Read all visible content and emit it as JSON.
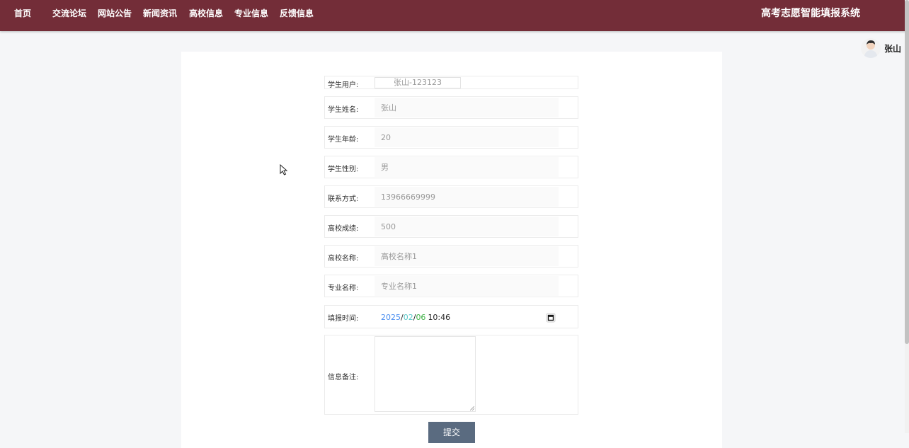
{
  "nav": {
    "items": [
      "首页",
      "交流论坛",
      "网站公告",
      "新闻资讯",
      "高校信息",
      "专业信息",
      "反馈信息"
    ],
    "brand": "高考志愿智能填报系统",
    "bg_color": "#732d38"
  },
  "user": {
    "name": "张山",
    "avatar_icon": "user-avatar"
  },
  "form": {
    "student_user_label": "学生用户:",
    "student_user_value": "张山-123123",
    "name_label": "学生姓名:",
    "name_value": "张山",
    "age_label": "学生年龄:",
    "age_value": "20",
    "gender_label": "学生性别:",
    "gender_value": "男",
    "phone_label": "联系方式:",
    "phone_value": "13966669999",
    "score_label": "高校成绩:",
    "score_value": "500",
    "school_label": "高校名称:",
    "school_value": "高校名称1",
    "major_label": "专业名称:",
    "major_value": "专业名称1",
    "time_label": "填报时间:",
    "time_year": "2025",
    "time_month": "02",
    "time_day": "06",
    "time_clock": "10:46",
    "date_sep": "/",
    "note_label": "信息备注:",
    "note_value": "",
    "submit_label": "提交"
  }
}
